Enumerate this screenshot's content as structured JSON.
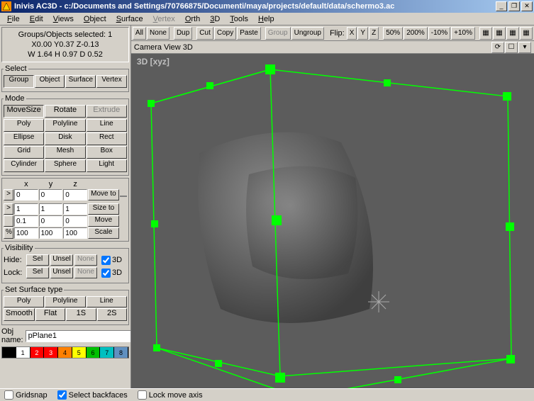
{
  "title": "Inivis AC3D - c:/Documents and Settings/70766875/Documenti/maya/projects/default/data/schermo3.ac",
  "menu": [
    "File",
    "Edit",
    "Views",
    "Object",
    "Surface",
    "Vertex",
    "Orth",
    "3D",
    "Tools",
    "Help"
  ],
  "menu_disabled": [
    5
  ],
  "info": {
    "line1": "Groups/Objects selected: 1",
    "line2": "X0.00 Y0.37 Z-0.13",
    "line3": "W 1.64 H 0.97 D 0.52"
  },
  "select": {
    "legend": "Select",
    "items": [
      "Group",
      "Object",
      "Surface",
      "Vertex"
    ],
    "active": 0
  },
  "mode": {
    "legend": "Mode",
    "row1": [
      "MoveSize",
      "Rotate",
      "Extrude"
    ],
    "row1_active": 0,
    "row1_disabled": [
      2
    ],
    "grid": [
      "Poly",
      "Polyline",
      "Line",
      "Ellipse",
      "Disk",
      "Rect",
      "Grid",
      "Mesh",
      "Box",
      "Cylinder",
      "Sphere",
      "Light"
    ]
  },
  "xyz": {
    "headers": [
      "x",
      "y",
      "z"
    ],
    "rows": [
      {
        "pre": ">",
        "x": "0",
        "y": "0",
        "z": "0",
        "btn": "Move to"
      },
      {
        "pre": ">",
        "x": "1",
        "y": "1",
        "z": "1",
        "btn": "Size to"
      },
      {
        "pre": "",
        "x": "0.1",
        "y": "0",
        "z": "0",
        "btn": "Move"
      },
      {
        "pre": "%",
        "x": "100",
        "y": "100",
        "z": "100",
        "btn": "Scale"
      }
    ]
  },
  "visibility": {
    "legend": "Visibility",
    "rows": [
      {
        "label": "Hide:",
        "b1": "Sel",
        "b2": "Unsel",
        "b3": "None",
        "cb": true,
        "cblabel": "3D"
      },
      {
        "label": "Lock:",
        "b1": "Sel",
        "b2": "Unsel",
        "b3": "None",
        "cb": true,
        "cblabel": "3D"
      }
    ]
  },
  "surftype": {
    "legend": "Set Surface type",
    "r1": [
      "Poly",
      "Polyline",
      "Line"
    ],
    "r2": [
      "Smooth",
      "Flat",
      "1S",
      "2S"
    ]
  },
  "objname": {
    "label": "Obj name:",
    "value": "pPlane1"
  },
  "palette": [
    {
      "c": "#000000",
      "n": ""
    },
    {
      "c": "#ffffff",
      "n": "1"
    },
    {
      "c": "#ff0000",
      "n": "2"
    },
    {
      "c": "#ff0000",
      "n": "3"
    },
    {
      "c": "#ff8000",
      "n": "4"
    },
    {
      "c": "#ffff00",
      "n": "5"
    },
    {
      "c": "#00c000",
      "n": "6"
    },
    {
      "c": "#00c0c0",
      "n": "7"
    },
    {
      "c": "#6090c0",
      "n": "8"
    }
  ],
  "toolbar": {
    "b": [
      "All",
      "None",
      "Dup",
      "Cut",
      "Copy",
      "Paste",
      "Group",
      "Ungroup"
    ],
    "disabled": [
      6
    ],
    "flip_label": "Flip:",
    "flip": [
      "X",
      "Y",
      "Z"
    ],
    "zoom": [
      "50%",
      "200%",
      "-10%",
      "+10%"
    ]
  },
  "viewport": {
    "title": "Camera View  3D",
    "label": "3D  [xyz]"
  },
  "status": {
    "gridsnap": {
      "label": "Gridsnap",
      "checked": false
    },
    "backfaces": {
      "label": "Select backfaces",
      "checked": true
    },
    "lockaxis": {
      "label": "Lock move axis",
      "checked": false
    }
  }
}
